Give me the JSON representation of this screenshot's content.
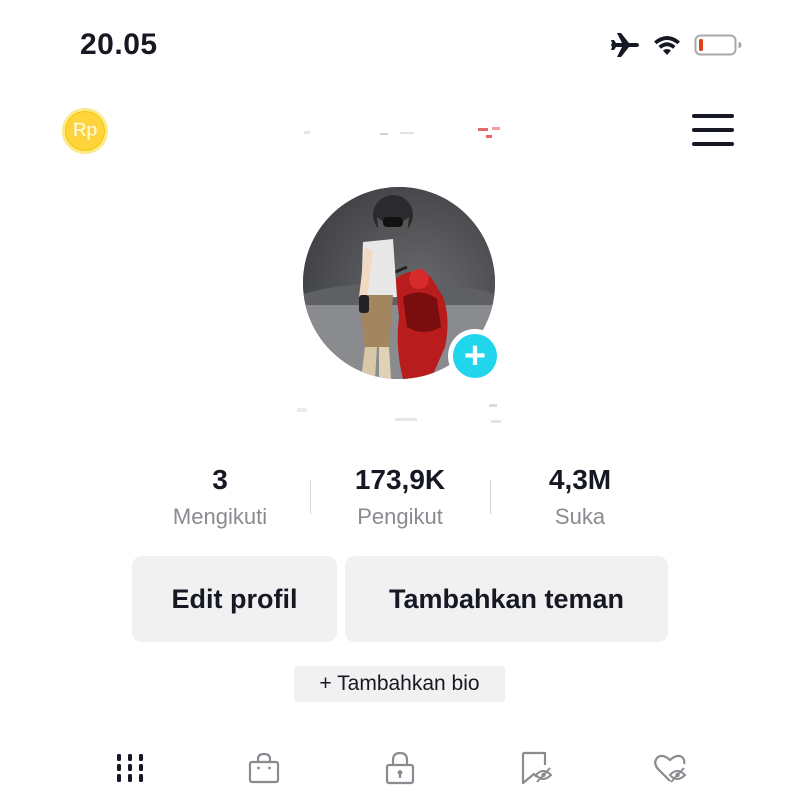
{
  "status_bar": {
    "time": "20.05",
    "icons": [
      "airplane-icon",
      "wifi-icon",
      "battery-low-icon"
    ],
    "battery_color": "#e0421b"
  },
  "header": {
    "coin_label": "Rp",
    "coin_color": "#ffd43b",
    "menu_icon": "hamburger-menu-icon"
  },
  "profile": {
    "avatar_add_icon": "plus-icon",
    "avatar_add_color": "#20d5ec"
  },
  "stats": [
    {
      "value": "3",
      "label": "Mengikuti"
    },
    {
      "value": "173,9K",
      "label": "Pengikut"
    },
    {
      "value": "4,3M",
      "label": "Suka"
    }
  ],
  "actions": {
    "edit_profile": "Edit profil",
    "add_friends": "Tambahkan teman"
  },
  "bio": {
    "add_bio": "+ Tambahkan bio"
  },
  "tabs": [
    {
      "icon": "videos-grid-icon",
      "active": true
    },
    {
      "icon": "shop-bag-icon",
      "active": false
    },
    {
      "icon": "private-lock-icon",
      "active": false
    },
    {
      "icon": "saved-bookmark-icon",
      "active": false
    },
    {
      "icon": "liked-heart-hidden-icon",
      "active": false
    }
  ]
}
